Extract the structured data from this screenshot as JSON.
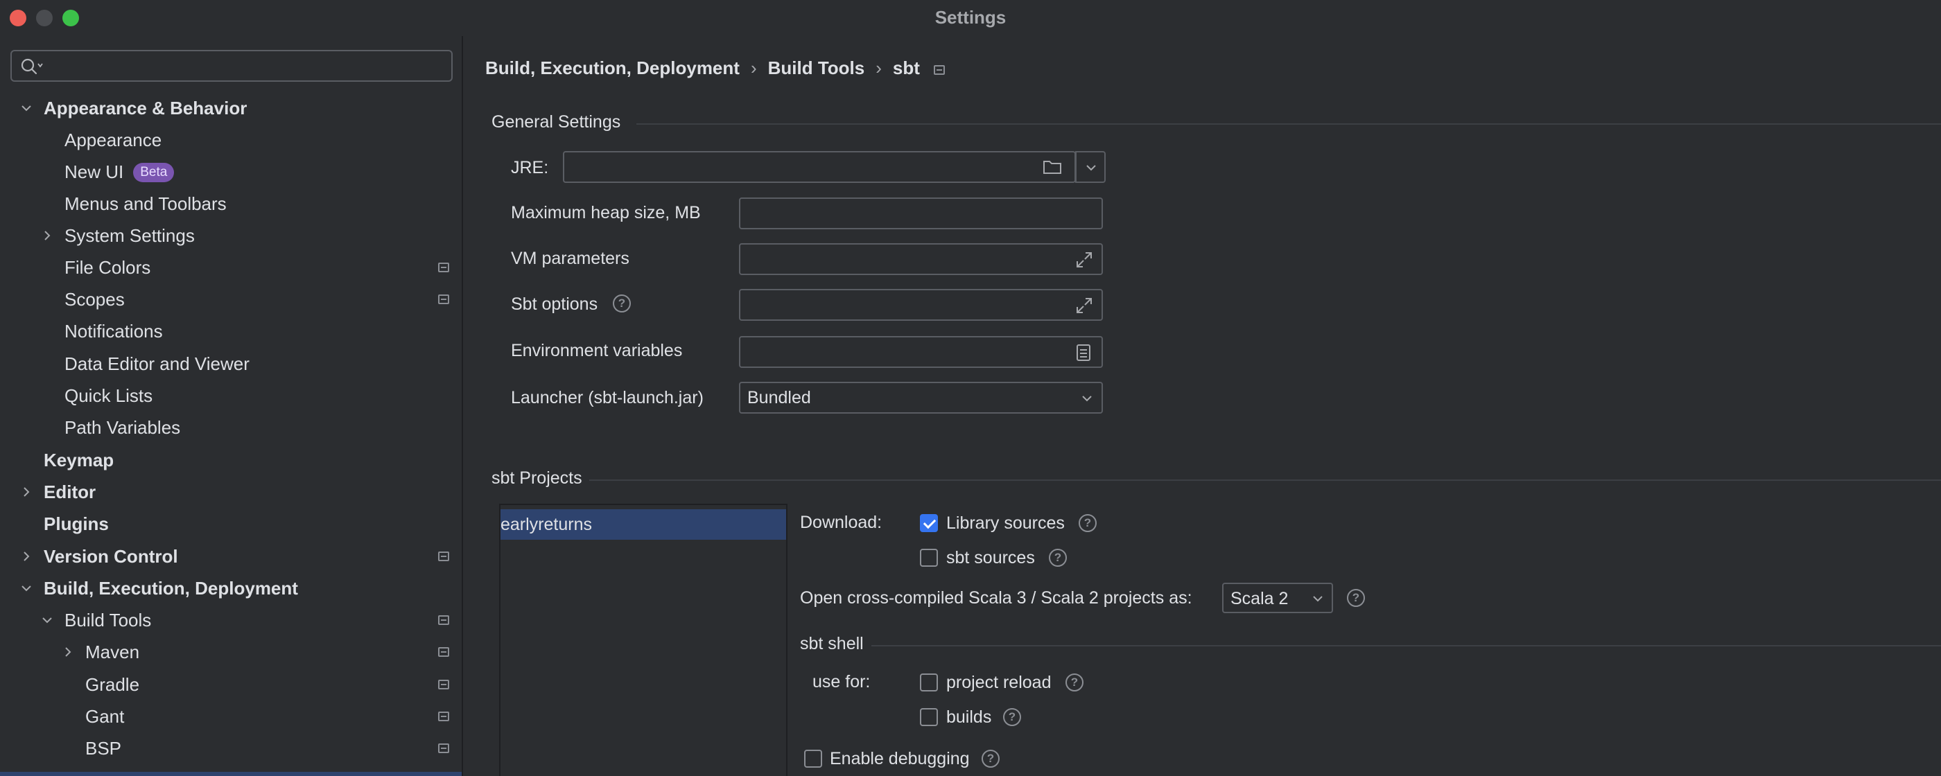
{
  "window": {
    "title": "Settings"
  },
  "sidebar": {
    "search": {
      "placeholder": "",
      "value": ""
    },
    "items": [
      {
        "label": "Appearance & Behavior",
        "expanded": true,
        "bold": true
      },
      {
        "label": "Appearance"
      },
      {
        "label": "New UI",
        "badge": "Beta"
      },
      {
        "label": "Menus and Toolbars"
      },
      {
        "label": "System Settings",
        "expanded": false
      },
      {
        "label": "File Colors",
        "project_level": true
      },
      {
        "label": "Scopes",
        "project_level": true
      },
      {
        "label": "Notifications"
      },
      {
        "label": "Data Editor and Viewer"
      },
      {
        "label": "Quick Lists"
      },
      {
        "label": "Path Variables"
      },
      {
        "label": "Keymap",
        "bold": true
      },
      {
        "label": "Editor",
        "expanded": false,
        "bold": true
      },
      {
        "label": "Plugins",
        "bold": true
      },
      {
        "label": "Version Control",
        "expanded": false,
        "bold": true,
        "project_level": true
      },
      {
        "label": "Build, Execution, Deployment",
        "expanded": true,
        "bold": true
      },
      {
        "label": "Build Tools",
        "expanded": true,
        "project_level": true
      },
      {
        "label": "Maven",
        "expanded": false,
        "project_level": true
      },
      {
        "label": "Gradle",
        "project_level": true
      },
      {
        "label": "Gant",
        "project_level": true
      },
      {
        "label": "BSP",
        "project_level": true
      }
    ]
  },
  "breadcrumb": {
    "items": [
      "Build, Execution, Deployment",
      "Build Tools",
      "sbt"
    ],
    "separator": "›"
  },
  "general_settings": {
    "title": "General Settings",
    "jre": {
      "label": "JRE:",
      "value": ""
    },
    "max_heap": {
      "label": "Maximum heap size, MB",
      "value": ""
    },
    "vm_parameters": {
      "label": "VM parameters",
      "value": ""
    },
    "sbt_options": {
      "label": "Sbt options",
      "value": ""
    },
    "env_vars": {
      "label": "Environment variables",
      "value": ""
    },
    "launcher": {
      "label": "Launcher (sbt-launch.jar)",
      "value": "Bundled"
    }
  },
  "sbt_projects": {
    "title": "sbt Projects",
    "projects": [
      "earlyreturns"
    ],
    "download_label": "Download:",
    "library_sources": {
      "label": "Library sources",
      "checked": true
    },
    "sbt_sources": {
      "label": "sbt sources",
      "checked": false
    },
    "open_cross_label": "Open cross-compiled Scala 3 / Scala 2 projects as:",
    "open_cross_value": "Scala 2",
    "sbt_shell_title": "sbt shell",
    "use_for_label": "use for:",
    "project_reload": {
      "label": "project reload",
      "checked": false
    },
    "builds": {
      "label": "builds",
      "checked": false
    },
    "enable_debugging": {
      "label": "Enable debugging",
      "checked": false
    }
  },
  "colors": {
    "accent": "#3574f0",
    "selection": "#2e436e",
    "badge": "#7a55b0",
    "close": "#ee5f57",
    "maximize": "#3cc24a"
  }
}
